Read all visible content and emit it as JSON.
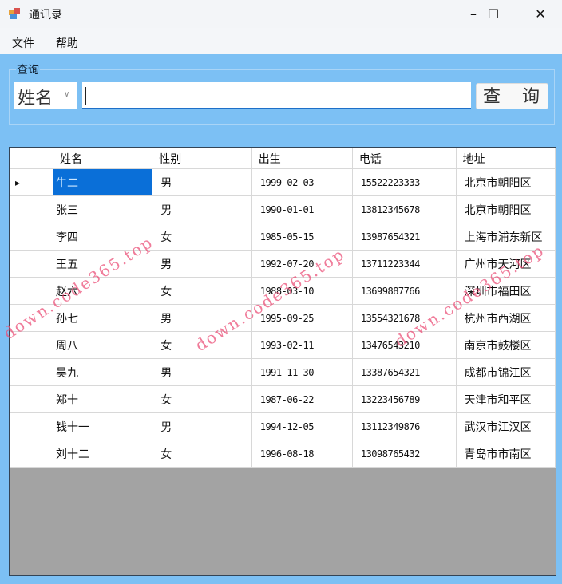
{
  "window": {
    "title": "通讯录",
    "minimize": "–",
    "maximize": "☐",
    "close": "✕"
  },
  "menu": [
    "文件",
    "帮助"
  ],
  "search": {
    "group_label": "查询",
    "field_selected": "姓名",
    "input_value": "",
    "button": "查 询"
  },
  "grid": {
    "columns": [
      "姓名",
      "性别",
      "出生",
      "电话",
      "地址"
    ],
    "current_row_marker": "▸",
    "rows": [
      [
        "牛二",
        "男",
        "1999-02-03",
        "15522223333",
        "北京市朝阳区"
      ],
      [
        "张三",
        "男",
        "1990-01-01",
        "13812345678",
        "北京市朝阳区"
      ],
      [
        "李四",
        "女",
        "1985-05-15",
        "13987654321",
        "上海市浦东新区"
      ],
      [
        "王五",
        "男",
        "1992-07-20",
        "13711223344",
        "广州市天河区"
      ],
      [
        "赵六",
        "女",
        "1988-03-10",
        "13699887766",
        "深圳市福田区"
      ],
      [
        "孙七",
        "男",
        "1995-09-25",
        "13554321678",
        "杭州市西湖区"
      ],
      [
        "周八",
        "女",
        "1993-02-11",
        "13476543210",
        "南京市鼓楼区"
      ],
      [
        "吴九",
        "男",
        "1991-11-30",
        "13387654321",
        "成都市锦江区"
      ],
      [
        "郑十",
        "女",
        "1987-06-22",
        "13223456789",
        "天津市和平区"
      ],
      [
        "钱十一",
        "男",
        "1994-12-05",
        "13112349876",
        "武汉市江汉区"
      ],
      [
        "刘十二",
        "女",
        "1996-08-18",
        "13098765432",
        "青岛市市南区"
      ]
    ]
  },
  "watermark": "down.code365.top"
}
